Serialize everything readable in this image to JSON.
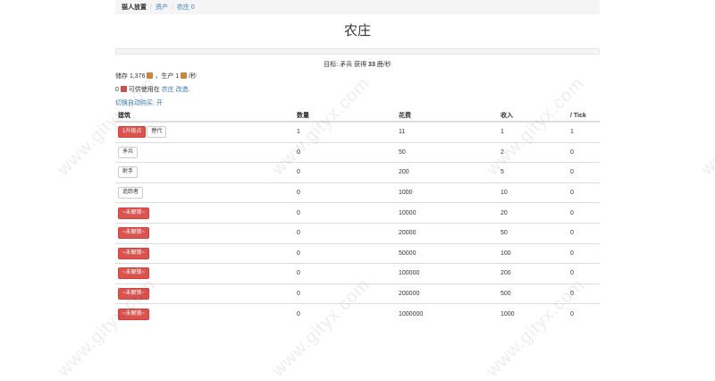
{
  "breadcrumb": {
    "home": "猫人放置",
    "assets": "资产",
    "current": "农庄 0"
  },
  "page": {
    "title": "农庄",
    "progress": 0
  },
  "goal": {
    "prefix": "目标: 矛兵 获得 ",
    "amount": "33",
    "suffix": " 鹿/秒"
  },
  "stock": {
    "prefix": "储存 1,376 ",
    "mid": " ，生产 1 ",
    "suffix": " /秒"
  },
  "meat": {
    "prefix": "0 ",
    "mid": " 可供使用在 ",
    "link": "农庄 改造",
    "end": "."
  },
  "autobuy": {
    "label": "切换自动购买: ",
    "state": "开"
  },
  "table": {
    "headers": [
      "建筑",
      "数量",
      "花费",
      "收入",
      "/ Tick"
    ],
    "rows": [
      {
        "buttons": [
          {
            "label": "1升级点",
            "danger": true
          },
          {
            "label": "替代",
            "danger": false
          }
        ],
        "count": "1",
        "cost": "11",
        "income": "1",
        "tick": "1"
      },
      {
        "buttons": [
          {
            "label": "矛兵",
            "danger": false
          }
        ],
        "count": "0",
        "cost": "50",
        "income": "2",
        "tick": "0"
      },
      {
        "buttons": [
          {
            "label": "射手",
            "danger": false
          }
        ],
        "count": "0",
        "cost": "200",
        "income": "5",
        "tick": "0"
      },
      {
        "buttons": [
          {
            "label": "追踪者",
            "danger": false
          }
        ],
        "count": "0",
        "cost": "1000",
        "income": "10",
        "tick": "0"
      },
      {
        "buttons": [
          {
            "label": "~未解锁~",
            "danger": true
          }
        ],
        "count": "0",
        "cost": "10000",
        "income": "20",
        "tick": "0"
      },
      {
        "buttons": [
          {
            "label": "~未解锁~",
            "danger": true
          }
        ],
        "count": "0",
        "cost": "20000",
        "income": "50",
        "tick": "0"
      },
      {
        "buttons": [
          {
            "label": "~未解锁~",
            "danger": true
          }
        ],
        "count": "0",
        "cost": "50000",
        "income": "100",
        "tick": "0"
      },
      {
        "buttons": [
          {
            "label": "~未解锁~",
            "danger": true
          }
        ],
        "count": "0",
        "cost": "100000",
        "income": "200",
        "tick": "0"
      },
      {
        "buttons": [
          {
            "label": "~未解锁~",
            "danger": true
          }
        ],
        "count": "0",
        "cost": "200000",
        "income": "500",
        "tick": "0"
      },
      {
        "buttons": [
          {
            "label": "~未解锁~",
            "danger": true
          }
        ],
        "count": "0",
        "cost": "1000000",
        "income": "1000",
        "tick": "0"
      }
    ]
  },
  "watermark": {
    "text": "www.gityx.com"
  },
  "colors": {
    "link": "#337ab7",
    "danger": "#d9534f",
    "grain_icon": "#c9863c",
    "meat_icon": "#c8524a"
  },
  "icons": {
    "grain": "grain-resource-icon",
    "meat": "meat-resource-icon"
  }
}
